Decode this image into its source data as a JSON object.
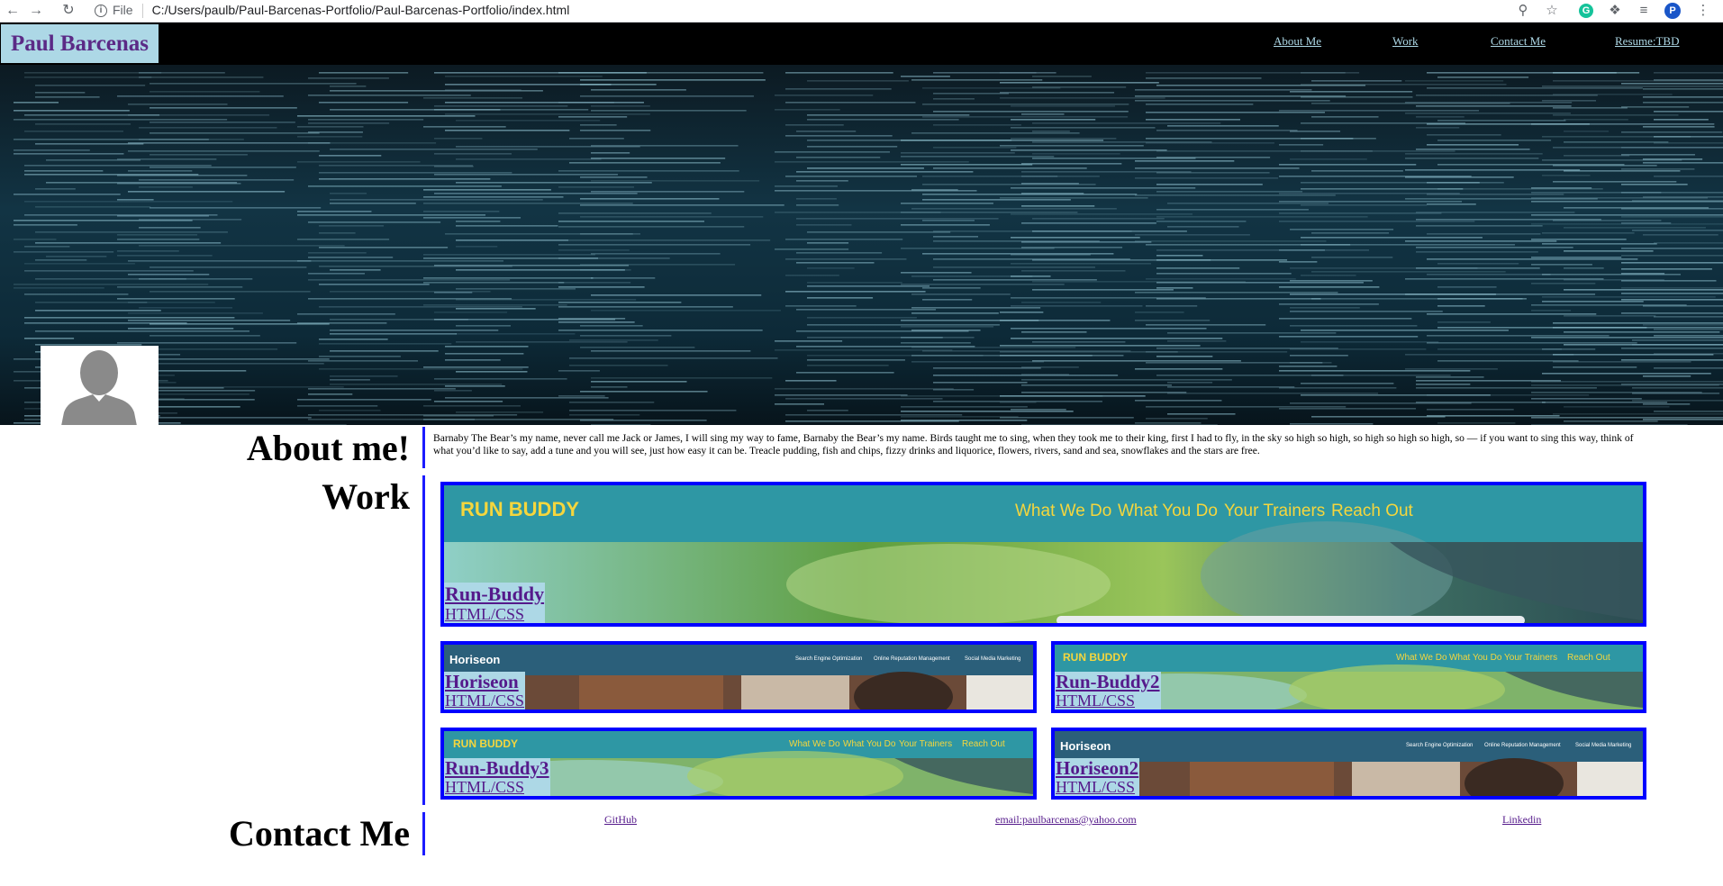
{
  "browser": {
    "scheme": "File",
    "url": "C:/Users/paulb/Paul-Barcenas-Portfolio/Paul-Barcenas-Portfolio/index.html",
    "grammarly_letter": "G",
    "profile_initial": "P"
  },
  "header": {
    "brand": "Paul Barcenas",
    "nav": [
      "About Me",
      "Work",
      "Contact Me",
      "Resume:TBD"
    ]
  },
  "about": {
    "title": "About me!",
    "text": "Barnaby The Bear’s my name, never call me Jack or James, I will sing my way to fame, Barnaby the Bear’s my name. Birds taught me to sing, when they took me to their king, first I had to fly, in the sky so high so high, so high so high so high, so — if you want to sing this way, think of what you’d like to say, add a tune and you will see, just how easy it can be. Treacle pudding, fish and chips, fizzy drinks and liquorice, flowers, rivers, sand and sea, snowflakes and the stars are free."
  },
  "work": {
    "title": "Work",
    "featured": {
      "name": "Run-Buddy",
      "tech": "HTML/CSS",
      "shot": {
        "logo": "RUN BUDDY",
        "nav": [
          "What We Do",
          "What You Do",
          "Your Trainers",
          "Reach Out"
        ]
      }
    },
    "projects": [
      {
        "name": "Horiseon",
        "tech": "HTML/CSS",
        "shot": {
          "logo": "Horiseon",
          "nav": [
            "Search Engine Optimization",
            "Online Reputation Management",
            "Social Media Marketing"
          ]
        }
      },
      {
        "name": "Run-Buddy2",
        "tech": "HTML/CSS",
        "shot": {
          "logo": "RUN BUDDY",
          "nav": [
            "What We Do",
            "What You Do",
            "Your Trainers",
            "Reach Out"
          ]
        }
      },
      {
        "name": "Run-Buddy3",
        "tech": "HTML/CSS",
        "shot": {
          "logo": "RUN BUDDY",
          "nav": [
            "What We Do",
            "What You Do",
            "Your Trainers",
            "Reach Out"
          ]
        }
      },
      {
        "name": "Horiseon2",
        "tech": "HTML/CSS",
        "shot": {
          "logo": "Horiseon",
          "nav": [
            "Search Engine Optimization",
            "Online Reputation Management",
            "Social Media Marketing"
          ]
        }
      }
    ]
  },
  "contact": {
    "title": "Contact Me",
    "links": [
      "GitHub",
      "email:paulbarcenas@yahoo.com",
      "Linkedin"
    ]
  },
  "colors": {
    "brand_bg": "#add8e6",
    "brand_text": "#5b2a86",
    "project_border": "#0000ff",
    "divider": "#1c1cff",
    "link_visited": "#551a8b",
    "runbuddy_header": "#2e97a4",
    "runbuddy_accent": "#f5d63d",
    "horiseon_header": "#2b5f7a"
  }
}
